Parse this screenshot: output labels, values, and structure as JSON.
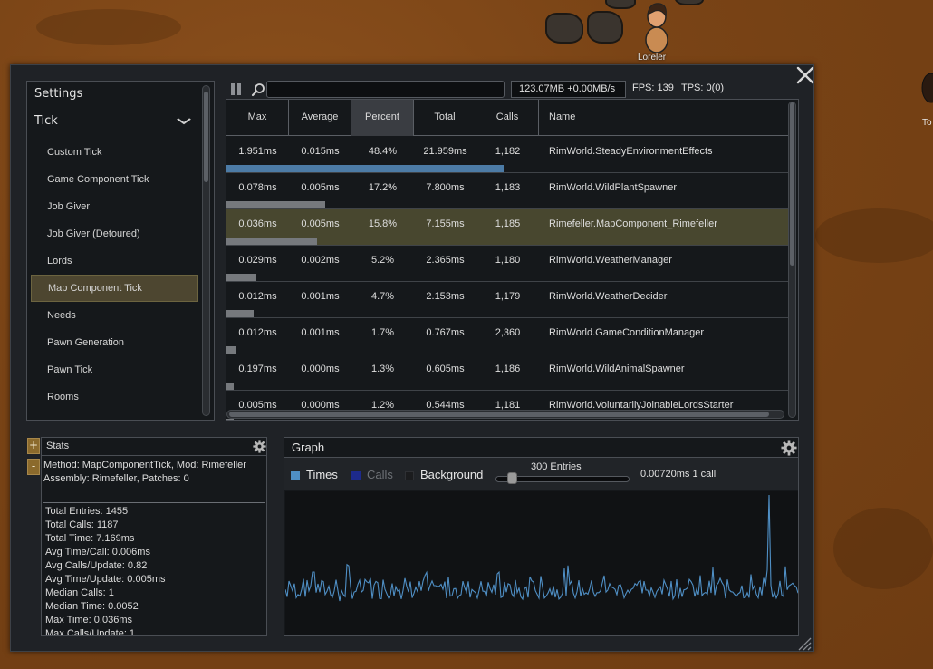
{
  "world": {
    "pawn_name": "Loreler",
    "pawn2_name": "To"
  },
  "settings": {
    "title": "Settings",
    "category": "Tick",
    "items": [
      {
        "label": "Custom Tick",
        "selected": false
      },
      {
        "label": "Game Component Tick",
        "selected": false
      },
      {
        "label": "Job Giver",
        "selected": false
      },
      {
        "label": "Job Giver (Detoured)",
        "selected": false
      },
      {
        "label": "Lords",
        "selected": false
      },
      {
        "label": "Map Component Tick",
        "selected": true
      },
      {
        "label": "Needs",
        "selected": false
      },
      {
        "label": "Pawn Generation",
        "selected": false
      },
      {
        "label": "Pawn Tick",
        "selected": false
      },
      {
        "label": "Rooms",
        "selected": false
      }
    ]
  },
  "toolbar": {
    "search_value": "",
    "memory": "123.07MB +0.00MB/s",
    "fps": "FPS: 139",
    "tps": "TPS: 0(0)"
  },
  "table": {
    "columns": [
      "Max",
      "Average",
      "Percent",
      "Total",
      "Calls",
      "Name"
    ],
    "sorted_column": "Percent",
    "rows": [
      {
        "max": "1.951ms",
        "avg": "0.015ms",
        "percent": "48.4%",
        "pct": 48.4,
        "total": "21.959ms",
        "calls": "1,182",
        "name": "RimWorld.SteadyEnvironmentEffects",
        "highlight": false
      },
      {
        "max": "0.078ms",
        "avg": "0.005ms",
        "percent": "17.2%",
        "pct": 17.2,
        "total": "7.800ms",
        "calls": "1,183",
        "name": "RimWorld.WildPlantSpawner",
        "highlight": false
      },
      {
        "max": "0.036ms",
        "avg": "0.005ms",
        "percent": "15.8%",
        "pct": 15.8,
        "total": "7.155ms",
        "calls": "1,185",
        "name": "Rimefeller.MapComponent_Rimefeller",
        "highlight": true
      },
      {
        "max": "0.029ms",
        "avg": "0.002ms",
        "percent": "5.2%",
        "pct": 5.2,
        "total": "2.365ms",
        "calls": "1,180",
        "name": "RimWorld.WeatherManager",
        "highlight": false
      },
      {
        "max": "0.012ms",
        "avg": "0.001ms",
        "percent": "4.7%",
        "pct": 4.7,
        "total": "2.153ms",
        "calls": "1,179",
        "name": "RimWorld.WeatherDecider",
        "highlight": false
      },
      {
        "max": "0.012ms",
        "avg": "0.001ms",
        "percent": "1.7%",
        "pct": 1.7,
        "total": "0.767ms",
        "calls": "2,360",
        "name": "RimWorld.GameConditionManager",
        "highlight": false
      },
      {
        "max": "0.197ms",
        "avg": "0.000ms",
        "percent": "1.3%",
        "pct": 1.3,
        "total": "0.605ms",
        "calls": "1,186",
        "name": "RimWorld.WildAnimalSpawner",
        "highlight": false
      },
      {
        "max": "0.005ms",
        "avg": "0.000ms",
        "percent": "1.2%",
        "pct": 1.2,
        "total": "0.544ms",
        "calls": "1,181",
        "name": "RimWorld.VoluntarilyJoinableLordsStarter",
        "highlight": false
      }
    ]
  },
  "stats": {
    "title": "Stats",
    "method": "Method: MapComponentTick, Mod: Rimefeller",
    "assembly": "Assembly: Rimefeller, Patches: 0",
    "lines": [
      "Total Entries: 1455",
      "Total Calls: 1187",
      "Total Time: 7.169ms",
      "Avg Time/Call: 0.006ms",
      "Avg Calls/Update: 0.82",
      "Avg Time/Update: 0.005ms",
      "Median Calls: 1",
      "Median Time: 0.0052",
      "Max Time: 0.036ms",
      "Max Calls/Update: 1"
    ],
    "plus_label": "+",
    "minus_label": "-"
  },
  "graph": {
    "title": "Graph",
    "legend": [
      {
        "label": "Times",
        "color": "#4f8fc5",
        "text_color": "#e6e6e6"
      },
      {
        "label": "Calls",
        "color": "#1d2a8c",
        "text_color": "#6e7277"
      },
      {
        "label": "Background",
        "color": "#1b1c1e",
        "text_color": "#e6e6e6"
      }
    ],
    "entries_label": "300 Entries",
    "entries_fraction": 0.12,
    "readout": "0.00720ms 1 call",
    "line_color": "#4f8fc5"
  },
  "colors": {
    "accent_bar": "#4c7ba6",
    "bar": "#76797d",
    "highlight_row": "#48472f",
    "selected_item": "#4d4630"
  }
}
